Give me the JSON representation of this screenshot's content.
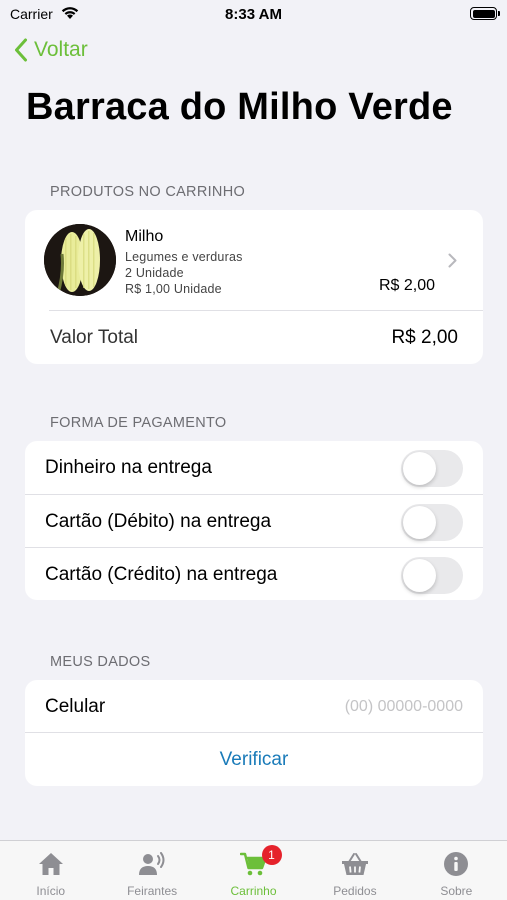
{
  "status_bar": {
    "carrier": "Carrier",
    "time": "8:33 AM"
  },
  "nav": {
    "back_label": "Voltar",
    "title": "Barraca do Milho Verde"
  },
  "cart": {
    "section_title": "PRODUTOS NO CARRINHO",
    "items": [
      {
        "name": "Milho",
        "category": "Legumes e verduras",
        "quantity": "2 Unidade",
        "unit_price": "R$ 1,00 Unidade",
        "price": "R$ 2,00"
      }
    ],
    "total_label": "Valor Total",
    "total_value": "R$ 2,00"
  },
  "payment": {
    "section_title": "FORMA DE PAGAMENTO",
    "options": [
      {
        "label": "Dinheiro na entrega",
        "enabled": false
      },
      {
        "label": "Cartão (Débito) na entrega",
        "enabled": false
      },
      {
        "label": "Cartão (Crédito) na entrega",
        "enabled": false
      }
    ]
  },
  "my_data": {
    "section_title": "MEUS DADOS",
    "phone_label": "Celular",
    "phone_placeholder": "(00) 00000-0000",
    "phone_value": "",
    "verify_label": "Verificar"
  },
  "tab_bar": {
    "active_color": "#6cbf3a",
    "inactive_color": "#8e8e93",
    "tabs": [
      {
        "label": "Início",
        "icon": "home-icon",
        "active": false
      },
      {
        "label": "Feirantes",
        "icon": "vendors-icon",
        "active": false
      },
      {
        "label": "Carrinho",
        "icon": "cart-icon",
        "active": true,
        "badge": "1"
      },
      {
        "label": "Pedidos",
        "icon": "basket-icon",
        "active": false
      },
      {
        "label": "Sobre",
        "icon": "info-icon",
        "active": false
      }
    ]
  }
}
